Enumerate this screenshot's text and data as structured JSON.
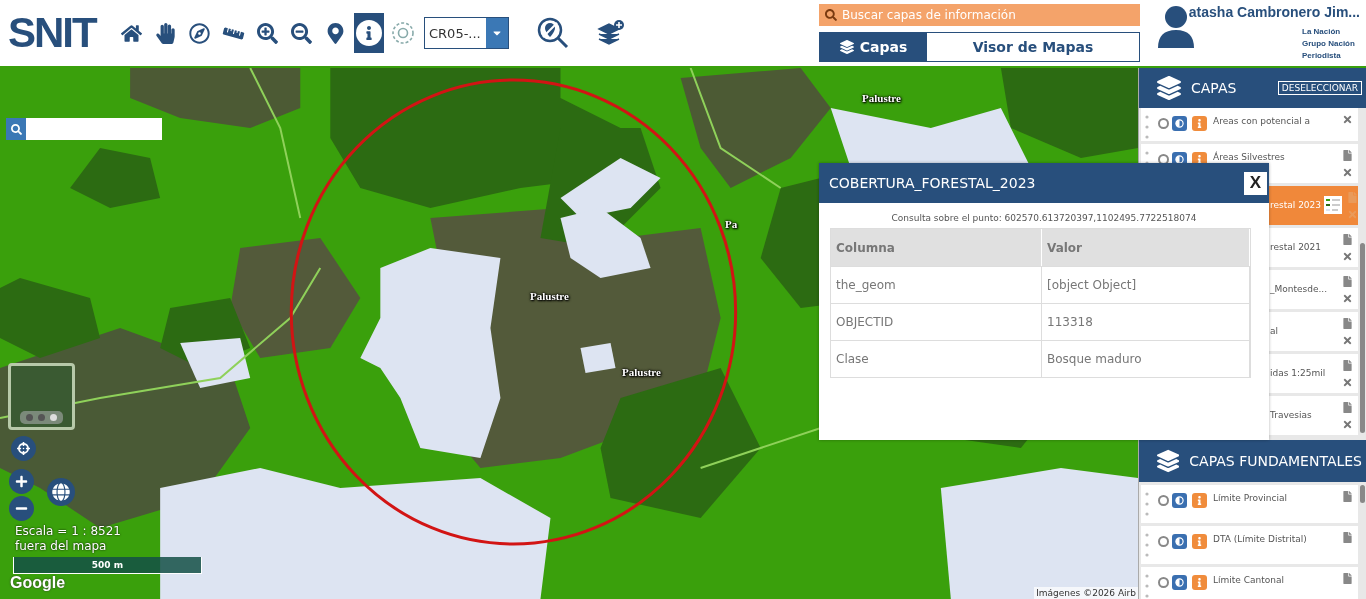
{
  "header": {
    "logo": "SNIT",
    "tools": [
      {
        "kind": "home",
        "selected": false
      },
      {
        "kind": "pan",
        "selected": false
      },
      {
        "kind": "compass",
        "selected": false
      },
      {
        "kind": "ruler",
        "selected": false
      },
      {
        "kind": "zoom_in",
        "selected": false
      },
      {
        "kind": "zoom_out",
        "selected": false
      },
      {
        "kind": "pin",
        "selected": false
      },
      {
        "kind": "info",
        "selected": true
      },
      {
        "kind": "area",
        "selected": false
      }
    ],
    "region_select": {
      "value": "CR05-..."
    },
    "actions": [
      {
        "kind": "search_map"
      },
      {
        "kind": "add_layer"
      }
    ],
    "layer_search": {
      "placeholder": "Buscar capas de información"
    },
    "tabs": [
      {
        "label": "Capas",
        "selected": true
      },
      {
        "label": "Visor de Mapas",
        "selected": false
      }
    ],
    "user": {
      "name": "atasha Cambronero Jim...",
      "org_lines": [
        "La Nación",
        "Grupo Nación",
        "Periodista"
      ]
    }
  },
  "map": {
    "labels": [
      "Palustre",
      "Palustre",
      "Palustre",
      "Pa"
    ],
    "scale": "Escala = 1 : 8521",
    "position": "fuera del mapa",
    "scale_bar": "500 m",
    "provider": "Google",
    "attribution": "Imágenes ©2026 Airb"
  },
  "popup": {
    "title": "COBERTURA_FORESTAL_2023",
    "close": "X",
    "query": "Consulta sobre el punto: 602570.613720397,1102495.7722518074",
    "columns": [
      "Columna",
      "Valor"
    ],
    "rows": [
      [
        "the_geom",
        "[object Object]"
      ],
      [
        "OBJECTID",
        "113318"
      ],
      [
        "Clase",
        "Bosque maduro"
      ]
    ]
  },
  "layers_panel": {
    "title": "CAPAS",
    "deselect": "DESELECCIONAR",
    "items": [
      {
        "name": "Areas con potencial a",
        "kind": "full",
        "selected": false,
        "document": false,
        "removable": true
      },
      {
        "name": "Áreas Silvestres",
        "kind": "full",
        "selected": false,
        "document": true,
        "removable": true
      },
      {
        "name": "restal 2023",
        "kind": "clipped",
        "selected": true,
        "document": true,
        "removable": true
      },
      {
        "name": "restal 2021",
        "kind": "clipped",
        "selected": false,
        "document": true,
        "removable": true
      },
      {
        "name": "_Montesde...",
        "kind": "clipped",
        "selected": false,
        "document": true,
        "removable": true
      },
      {
        "name": "al",
        "kind": "clipped",
        "selected": false,
        "document": true,
        "removable": true
      },
      {
        "name": "idas 1:25mil",
        "kind": "clipped",
        "selected": false,
        "document": true,
        "removable": true
      },
      {
        "name": "Travesias",
        "kind": "clipped",
        "selected": false,
        "document": true,
        "removable": true
      }
    ]
  },
  "base_panel": {
    "title": "CAPAS FUNDAMENTALES",
    "items": [
      {
        "name": "Límite Provincial",
        "kind": "full",
        "selected": false,
        "document": true,
        "removable": false
      },
      {
        "name": "DTA (Límite Distrital)",
        "kind": "full",
        "selected": false,
        "document": true,
        "removable": false
      },
      {
        "name": "Límite Cantonal",
        "kind": "full",
        "selected": false,
        "document": true,
        "removable": false
      }
    ]
  }
}
